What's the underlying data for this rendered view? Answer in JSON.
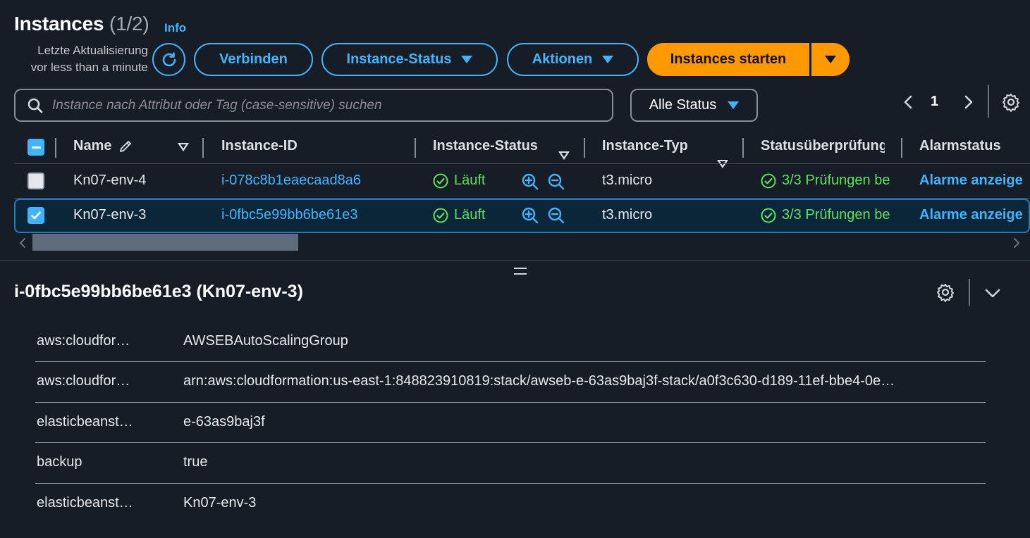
{
  "header": {
    "title": "Instances",
    "count": "(1/2)",
    "info": "Info",
    "last_update_line1": "Letzte Aktualisierung",
    "last_update_line2": "vor less than a minute"
  },
  "toolbar": {
    "connect": "Verbinden",
    "instance_state": "Instance-Status",
    "actions": "Aktionen",
    "launch": "Instances starten"
  },
  "filter": {
    "search_placeholder": "Instance nach Attribut oder Tag (case-sensitive) suchen",
    "status_select": "Alle Status"
  },
  "pagination": {
    "page": "1"
  },
  "table": {
    "columns": [
      "Name",
      "Instance-ID",
      "Instance-Status",
      "Instance-Typ",
      "Statusüberprüfung",
      "Alarmstatus"
    ],
    "rows": [
      {
        "name": "Kn07-env-4",
        "id": "i-078c8b1eaecaad8a6",
        "status": "Läuft",
        "type": "t3.micro",
        "check": "3/3 Prüfungen be",
        "alarm": "Alarme anzeige",
        "selected": false
      },
      {
        "name": "Kn07-env-3",
        "id": "i-0fbc5e99bb6be61e3",
        "status": "Läuft",
        "type": "t3.micro",
        "check": "3/3 Prüfungen be",
        "alarm": "Alarme anzeige",
        "selected": true
      }
    ]
  },
  "detail": {
    "title": "i-0fbc5e99bb6be61e3 (Kn07-env-3)",
    "tags": [
      {
        "key": "aws:cloudfor…",
        "value": "AWSEBAutoScalingGroup"
      },
      {
        "key": "aws:cloudfor…",
        "value": "arn:aws:cloudformation:us-east-1:848823910819:stack/awseb-e-63as9baj3f-stack/a0f3c630-d189-11ef-bbe4-0e…"
      },
      {
        "key": "elasticbeanst…",
        "value": "e-63as9baj3f"
      },
      {
        "key": "backup",
        "value": "true"
      },
      {
        "key": "elasticbeanst…",
        "value": "Kn07-env-3"
      }
    ]
  },
  "icons": [
    "refresh-icon",
    "search-icon",
    "chevron-left-icon",
    "chevron-right-icon",
    "gear-icon",
    "edit-pencil-icon",
    "sort-down-icon",
    "check-circle-icon",
    "zoom-in-icon",
    "zoom-out-icon",
    "chevron-down-icon",
    "drag-handle-icon"
  ],
  "colors": {
    "accent": "#42b4ff",
    "primary": "#ff9900",
    "success": "#29ad32",
    "background": "#161d26",
    "selected_row": "#0b2638"
  }
}
